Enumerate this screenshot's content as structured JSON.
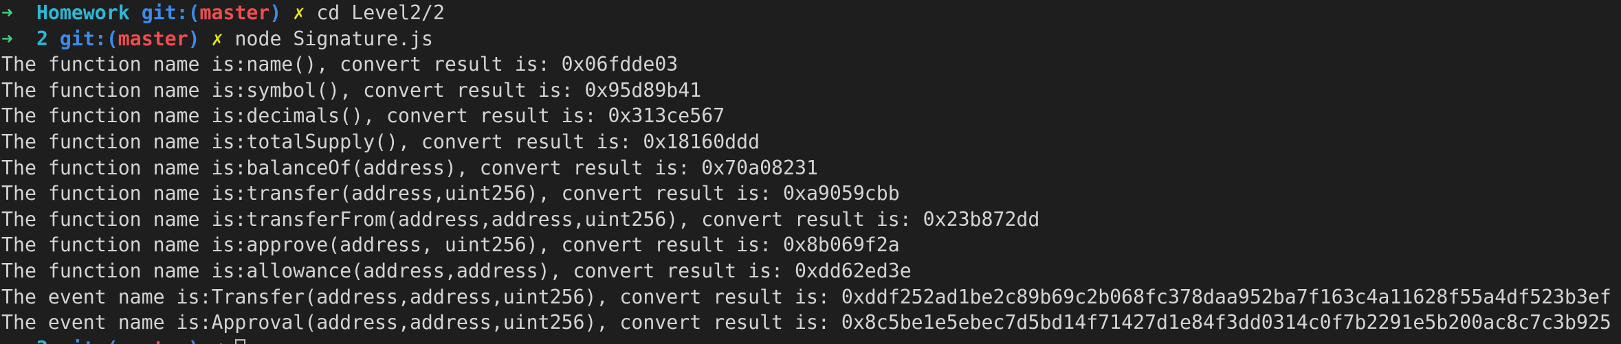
{
  "prompts": [
    {
      "arrow": "➜",
      "dir": "Homework",
      "git_label": "git:(",
      "branch": "master",
      "git_close": ")",
      "dirty": "✗",
      "command": "cd Level2/2"
    },
    {
      "arrow": "➜",
      "dir": "2",
      "git_label": "git:(",
      "branch": "master",
      "git_close": ")",
      "dirty": "✗",
      "command": "node Signature.js"
    }
  ],
  "output": [
    "The function name is:name(), convert result is: 0x06fdde03",
    "The function name is:symbol(), convert result is: 0x95d89b41",
    "The function name is:decimals(), convert result is: 0x313ce567",
    "The function name is:totalSupply(), convert result is: 0x18160ddd",
    "The function name is:balanceOf(address), convert result is: 0x70a08231",
    "The function name is:transfer(address,uint256), convert result is: 0xa9059cbb",
    "The function name is:transferFrom(address,address,uint256), convert result is: 0x23b872dd",
    "The function name is:approve(address, uint256), convert result is: 0x8b069f2a",
    "The function name is:allowance(address,address), convert result is: 0xdd62ed3e",
    "The event name is:Transfer(address,address,uint256), convert result is: 0xddf252ad1be2c89b69c2b068fc378daa952ba7f163c4a11628f55a4df523b3ef",
    "The event name is:Approval(address,address,uint256), convert result is: 0x8c5be1e5ebec7d5bd14f71427d1e84f3dd0314c0f7b2291e5b200ac8c7c3b925"
  ],
  "colors": {
    "background": "#1e1e1e",
    "text": "#d4d4d4",
    "arrow": "#3fcf7f",
    "dir": "#2fb8d6",
    "git": "#3d8bea",
    "branch": "#ef4d50",
    "dirty": "#e8e61a"
  }
}
